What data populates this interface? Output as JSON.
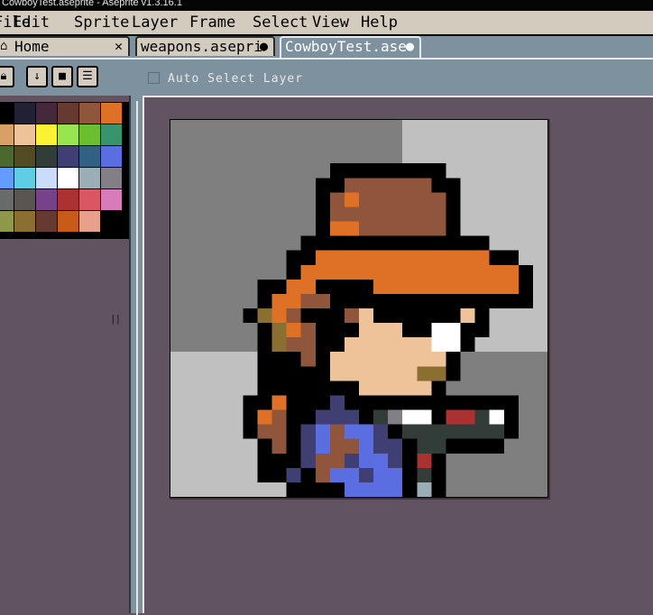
{
  "window": {
    "title": "CowboyTest.aseprite - Aseprite v1.3.16.1"
  },
  "menu": [
    "File",
    "Edit",
    "Sprite",
    "Layer",
    "Frame",
    "Select",
    "View",
    "Help"
  ],
  "tabs": [
    {
      "label": "Home",
      "control": "✕",
      "active": false
    },
    {
      "label": "weapons.asepri",
      "control": "●",
      "active": false
    },
    {
      "label": "CowboyTest.ase",
      "control": "●",
      "active": true
    }
  ],
  "context_bar": {
    "auto_select_label": "Auto Select Layer"
  },
  "toolbar_icons": [
    "lock-icon",
    "arrow-down-icon",
    "square-icon",
    "menu-icon"
  ],
  "palette": [
    "#000000",
    "#222034",
    "#45283c",
    "#663931",
    "#8f563b",
    "#df7126",
    "#d9a066",
    "#eec39a",
    "#fbf236",
    "#99e550",
    "#6abe30",
    "#37946e",
    "#4b692f",
    "#524b24",
    "#323c39",
    "#3f3f74",
    "#306082",
    "#5b6ee1",
    "#639bff",
    "#5fcde4",
    "#cbdbfc",
    "#ffffff",
    "#9badb7",
    "#847e87",
    "#696a6a",
    "#595652",
    "#76428a",
    "#ac3232",
    "#d95763",
    "#d77bba",
    "#8f974a",
    "#8a6f30",
    "#663931",
    "#c65b1a",
    "#e8a08a"
  ],
  "colors": {
    "menu_bg": "#d3cbbe",
    "toolbar_bg": "#7d929e",
    "workspace_bg": "#625360",
    "sprite_bg_dark": "#7f7f7f",
    "sprite_bg_light": "#c0c0c0"
  }
}
